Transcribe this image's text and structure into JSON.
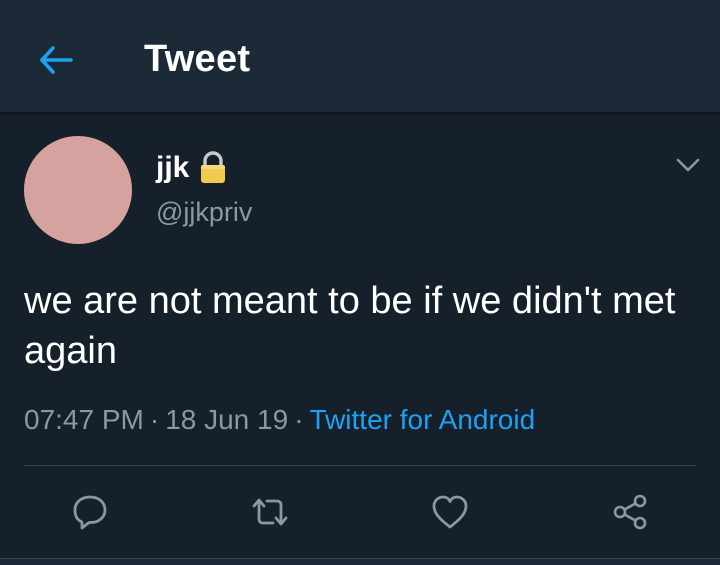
{
  "header": {
    "title": "Tweet",
    "back_icon": "arrow-left-icon"
  },
  "colors": {
    "background": "#15202b",
    "header_bg": "#1c2a38",
    "accent": "#1da1f2",
    "secondary_text": "#8899a6",
    "avatar": "#d6a2a0"
  },
  "tweet": {
    "display_name": "jjk",
    "protected_icon": "lock-icon",
    "handle": "@jjkpriv",
    "text": "we are not meant to be if we didn't met again",
    "time": "07:47 PM",
    "separator": "·",
    "date": "18 Jun 19",
    "source": "Twitter for Android"
  },
  "actions": [
    {
      "name": "reply",
      "icon": "reply-icon"
    },
    {
      "name": "retweet",
      "icon": "retweet-icon"
    },
    {
      "name": "like",
      "icon": "heart-icon"
    },
    {
      "name": "share",
      "icon": "share-icon"
    }
  ]
}
